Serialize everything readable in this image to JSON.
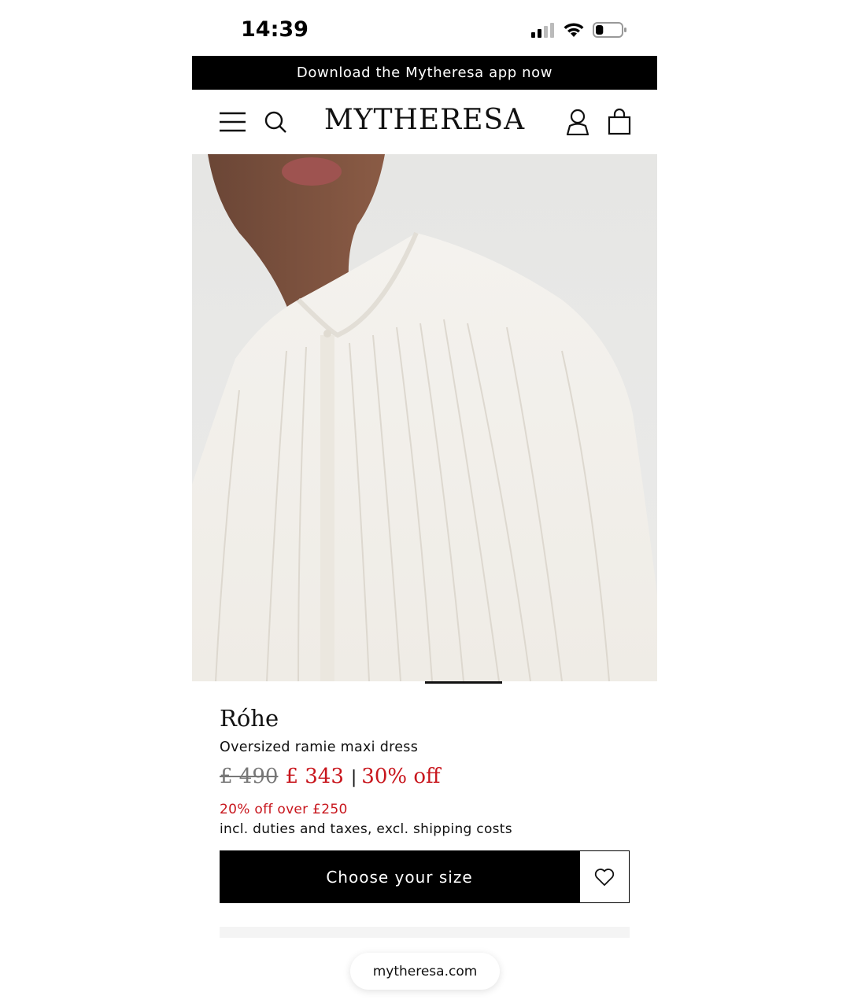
{
  "status_bar": {
    "time": "14:39",
    "battery_level": 0.3
  },
  "banner": {
    "text": "Download the Mytheresa app now"
  },
  "header": {
    "logo": "MYTHERESA",
    "icons": [
      "menu-icon",
      "search-icon",
      "account-icon",
      "shopping-bag-icon"
    ]
  },
  "product": {
    "brand": "Róhe",
    "name": "Oversized ramie maxi dress",
    "old_price": "£ 490",
    "new_price": "£ 343",
    "separator": "|",
    "discount": "30% off",
    "promo": "20% off over £250",
    "tax_note": "incl. duties and taxes, excl. shipping costs",
    "cta_label": "Choose your size"
  },
  "browser": {
    "url": "mytheresa.com"
  },
  "colors": {
    "accent_red": "#c8161d",
    "black": "#000000"
  }
}
